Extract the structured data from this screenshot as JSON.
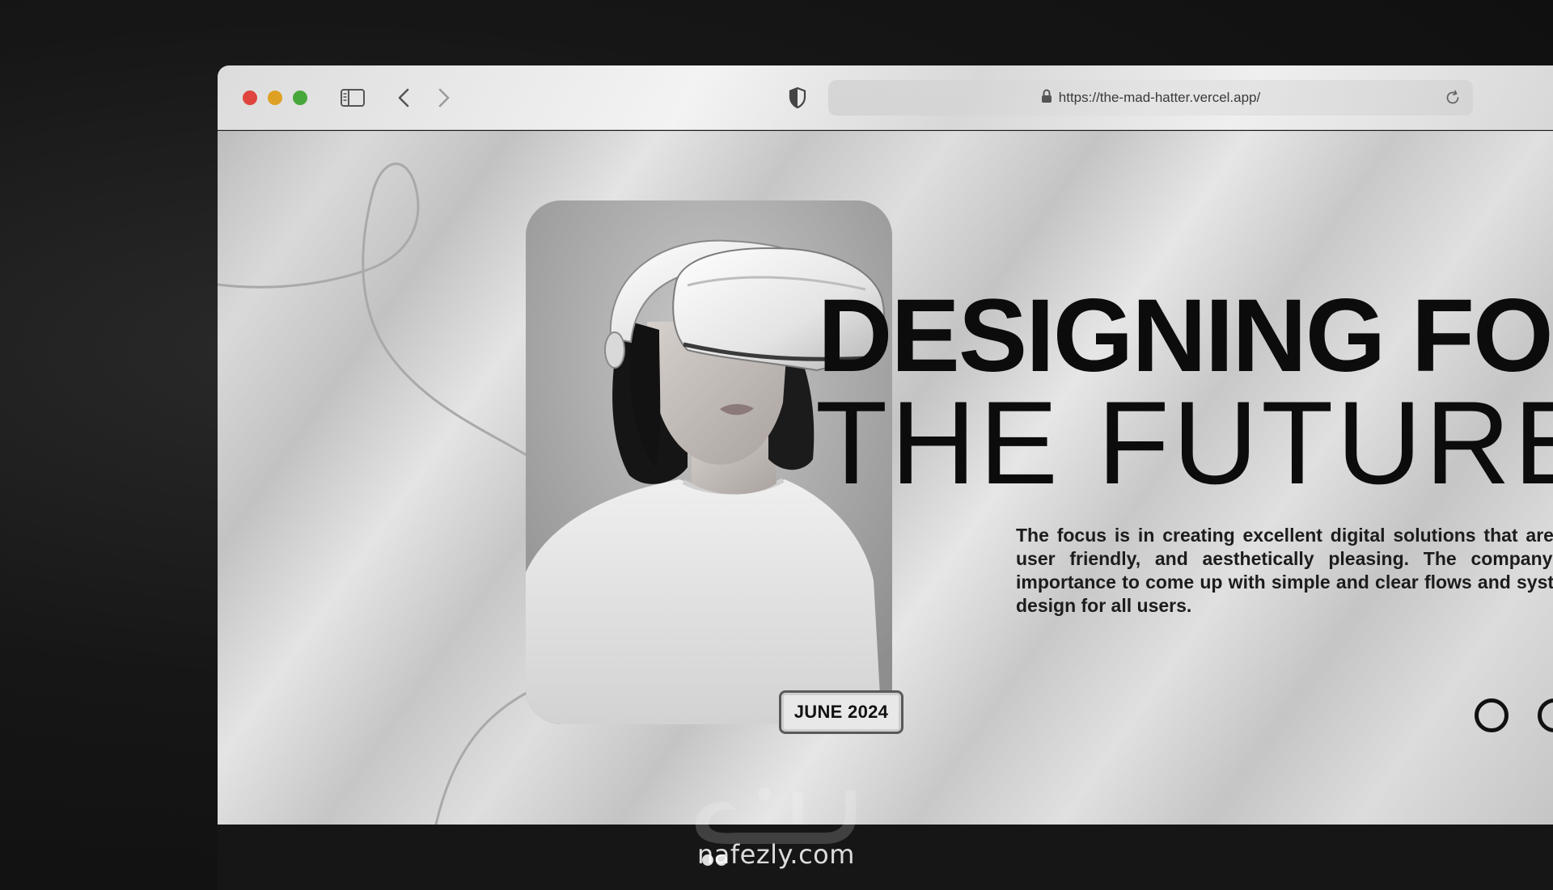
{
  "browser": {
    "url": "https://the-mad-hatter.vercel.app/",
    "icons": {
      "sidebar": "sidebar-toggle-icon",
      "back": "chevron-left-icon",
      "forward": "chevron-right-icon",
      "privacy": "shield-icon",
      "lock": "lock-icon",
      "reload": "reload-icon"
    },
    "traffic_lights": {
      "close": "#e0443e",
      "minimize": "#dea123",
      "maximize": "#48a73a"
    }
  },
  "hero": {
    "headline_line1": "DESIGNING FOR",
    "headline_line2": "THE FUTURE",
    "description": "The focus is in creating excellent digital solutions that are clean, user friendly, and aesthetically pleasing. The company gives importance to come up with simple and clear flows and systems of design for all users.",
    "date_badge": "JUNE 2024",
    "image": "woman-wearing-vr-headset"
  },
  "watermark": {
    "text": "nafezly.com"
  }
}
